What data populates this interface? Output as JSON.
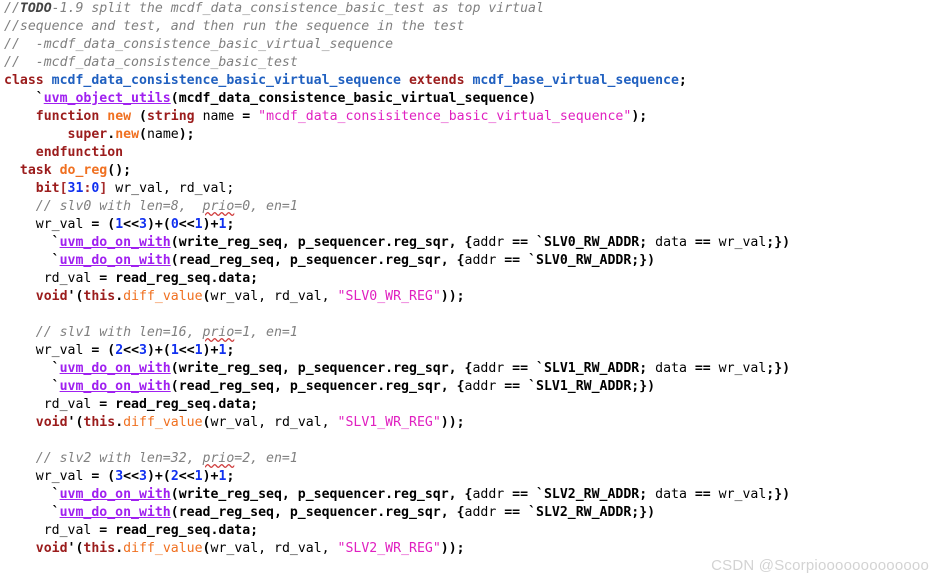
{
  "editor": {
    "language": "SystemVerilog",
    "background": "#ffffff",
    "font_size_px": 13.2,
    "line_height_px": 18
  },
  "colors": {
    "comment": "#808080",
    "keyword": "#9b1c1c",
    "type": "#2060c0",
    "string": "#e020c0",
    "macro": "#a020f0",
    "function": "#f07020",
    "number": "#1030f0",
    "plain": "#000000",
    "watermark": "#d3d3d3"
  },
  "watermark": {
    "text": "CSDN @Scorpiooooooooooooo"
  },
  "code": {
    "lines": [
      {
        "n": 1,
        "indent": 0,
        "tokens": [
          {
            "t": "//",
            "c": "c-comment"
          },
          {
            "t": "TODO",
            "c": "c-commentb"
          },
          {
            "t": "-1.9 split the mcdf_data_consistence_basic_test as top virtual",
            "c": "c-comment"
          }
        ]
      },
      {
        "n": 2,
        "indent": 0,
        "tokens": [
          {
            "t": "//sequence and test, and then run the sequence in the test",
            "c": "c-comment"
          }
        ]
      },
      {
        "n": 3,
        "indent": 0,
        "tokens": [
          {
            "t": "//  -mcdf_data_consistence_basic_virtual_sequence",
            "c": "c-comment"
          }
        ]
      },
      {
        "n": 4,
        "indent": 0,
        "tokens": [
          {
            "t": "//  -mcdf_data_consistence_basic_test",
            "c": "c-comment"
          }
        ]
      },
      {
        "n": 5,
        "indent": 0,
        "tokens": [
          {
            "t": "class",
            "c": "c-keyword"
          },
          {
            "t": " ",
            "c": "c-plain"
          },
          {
            "t": "mcdf_data_consistence_basic_virtual_sequence",
            "c": "c-type"
          },
          {
            "t": " ",
            "c": "c-plain"
          },
          {
            "t": "extends",
            "c": "c-keyword"
          },
          {
            "t": " ",
            "c": "c-plain"
          },
          {
            "t": "mcdf_base_virtual_sequence",
            "c": "c-type"
          },
          {
            "t": ";",
            "c": "c-punct"
          }
        ]
      },
      {
        "n": 6,
        "indent": 4,
        "tokens": [
          {
            "t": "`",
            "c": "c-tick"
          },
          {
            "t": "uvm_object_utils",
            "c": "c-macro"
          },
          {
            "t": "(",
            "c": "c-punct"
          },
          {
            "t": "mcdf_data_consistence_basic_virtual_sequence",
            "c": "c-bold"
          },
          {
            "t": ")",
            "c": "c-punct"
          }
        ]
      },
      {
        "n": 7,
        "indent": 4,
        "tokens": [
          {
            "t": "function",
            "c": "c-keyword"
          },
          {
            "t": " ",
            "c": "c-plain"
          },
          {
            "t": "new",
            "c": "c-func"
          },
          {
            "t": " (",
            "c": "c-punct"
          },
          {
            "t": "string",
            "c": "c-keyword"
          },
          {
            "t": " ",
            "c": "c-plain"
          },
          {
            "t": "name",
            "c": "c-plain"
          },
          {
            "t": " = ",
            "c": "c-punct"
          },
          {
            "t": "\"mcdf_data_consisitence_basic_virtual_sequence\"",
            "c": "c-string"
          },
          {
            "t": ");",
            "c": "c-punct"
          }
        ]
      },
      {
        "n": 8,
        "indent": 8,
        "tokens": [
          {
            "t": "super",
            "c": "c-keyword"
          },
          {
            "t": ".",
            "c": "c-punct"
          },
          {
            "t": "new",
            "c": "c-func"
          },
          {
            "t": "(",
            "c": "c-punct"
          },
          {
            "t": "name",
            "c": "c-plain"
          },
          {
            "t": ");",
            "c": "c-punct"
          }
        ]
      },
      {
        "n": 9,
        "indent": 4,
        "tokens": [
          {
            "t": "endfunction",
            "c": "c-keyword"
          }
        ]
      },
      {
        "n": 10,
        "indent": 2,
        "tokens": [
          {
            "t": "task",
            "c": "c-keyword"
          },
          {
            "t": " ",
            "c": "c-plain"
          },
          {
            "t": "do_reg",
            "c": "c-func"
          },
          {
            "t": "();",
            "c": "c-punct"
          }
        ]
      },
      {
        "n": 11,
        "indent": 4,
        "tokens": [
          {
            "t": "bit",
            "c": "c-keyword"
          },
          {
            "t": "[",
            "c": "c-kw2"
          },
          {
            "t": "31",
            "c": "c-num"
          },
          {
            "t": ":",
            "c": "c-kw2"
          },
          {
            "t": "0",
            "c": "c-num"
          },
          {
            "t": "]",
            "c": "c-kw2"
          },
          {
            "t": " ",
            "c": "c-plain"
          },
          {
            "t": "wr_val, rd_val;",
            "c": "c-plain"
          }
        ]
      },
      {
        "n": 12,
        "indent": 4,
        "tokens": [
          {
            "t": "// slv0 with len=8,  ",
            "c": "c-comment"
          },
          {
            "t": "prio",
            "c": "c-comment c-squiggle"
          },
          {
            "t": "=0, en=1",
            "c": "c-comment"
          }
        ]
      },
      {
        "n": 13,
        "indent": 4,
        "tokens": [
          {
            "t": "wr_val",
            "c": "c-plain"
          },
          {
            "t": " = ",
            "c": "c-punct"
          },
          {
            "t": "(",
            "c": "c-punct"
          },
          {
            "t": "1",
            "c": "c-num"
          },
          {
            "t": "<<",
            "c": "c-punct"
          },
          {
            "t": "3",
            "c": "c-num"
          },
          {
            "t": ")+(",
            "c": "c-punct"
          },
          {
            "t": "0",
            "c": "c-num"
          },
          {
            "t": "<<",
            "c": "c-punct"
          },
          {
            "t": "1",
            "c": "c-num"
          },
          {
            "t": ")+",
            "c": "c-punct"
          },
          {
            "t": "1",
            "c": "c-num"
          },
          {
            "t": ";",
            "c": "c-punct"
          }
        ]
      },
      {
        "n": 14,
        "indent": 6,
        "tokens": [
          {
            "t": "`",
            "c": "c-tick"
          },
          {
            "t": "uvm_do_on_with",
            "c": "c-macro"
          },
          {
            "t": "(",
            "c": "c-punct"
          },
          {
            "t": "write_reg_seq, p_sequencer.reg_sqr, {",
            "c": "c-bold"
          },
          {
            "t": "addr",
            "c": "c-plain"
          },
          {
            "t": " == ",
            "c": "c-punct"
          },
          {
            "t": "`",
            "c": "c-tick"
          },
          {
            "t": "SLV0_RW_ADDR",
            "c": "c-bold"
          },
          {
            "t": "; ",
            "c": "c-punct"
          },
          {
            "t": "data",
            "c": "c-plain"
          },
          {
            "t": " == ",
            "c": "c-punct"
          },
          {
            "t": "wr_val",
            "c": "c-plain"
          },
          {
            "t": ";})",
            "c": "c-punct"
          }
        ]
      },
      {
        "n": 15,
        "indent": 6,
        "tokens": [
          {
            "t": "`",
            "c": "c-tick"
          },
          {
            "t": "uvm_do_on_with",
            "c": "c-macro"
          },
          {
            "t": "(",
            "c": "c-punct"
          },
          {
            "t": "read_reg_seq, p_sequencer.reg_sqr, {",
            "c": "c-bold"
          },
          {
            "t": "addr",
            "c": "c-plain"
          },
          {
            "t": " == ",
            "c": "c-punct"
          },
          {
            "t": "`",
            "c": "c-tick"
          },
          {
            "t": "SLV0_RW_ADDR",
            "c": "c-bold"
          },
          {
            "t": ";})",
            "c": "c-punct"
          }
        ]
      },
      {
        "n": 16,
        "indent": 5,
        "tokens": [
          {
            "t": "rd_val",
            "c": "c-plain"
          },
          {
            "t": " = ",
            "c": "c-punct"
          },
          {
            "t": "read_reg_seq.data;",
            "c": "c-bold"
          }
        ]
      },
      {
        "n": 17,
        "indent": 4,
        "tokens": [
          {
            "t": "void",
            "c": "c-keyword"
          },
          {
            "t": "'(",
            "c": "c-punct"
          },
          {
            "t": "this",
            "c": "c-keyword"
          },
          {
            "t": ".",
            "c": "c-punct"
          },
          {
            "t": "diff_value",
            "c": "c-func2"
          },
          {
            "t": "(",
            "c": "c-punct"
          },
          {
            "t": "wr_val, rd_val, ",
            "c": "c-plain"
          },
          {
            "t": "\"SLV0_WR_REG\"",
            "c": "c-string"
          },
          {
            "t": "));",
            "c": "c-punct"
          }
        ]
      },
      {
        "n": 18,
        "indent": 0,
        "tokens": []
      },
      {
        "n": 19,
        "indent": 4,
        "tokens": [
          {
            "t": "// slv1 with len=16, ",
            "c": "c-comment"
          },
          {
            "t": "prio",
            "c": "c-comment c-squiggle"
          },
          {
            "t": "=1, en=1",
            "c": "c-comment"
          }
        ]
      },
      {
        "n": 20,
        "indent": 4,
        "tokens": [
          {
            "t": "wr_val",
            "c": "c-plain"
          },
          {
            "t": " = ",
            "c": "c-punct"
          },
          {
            "t": "(",
            "c": "c-punct"
          },
          {
            "t": "2",
            "c": "c-num"
          },
          {
            "t": "<<",
            "c": "c-punct"
          },
          {
            "t": "3",
            "c": "c-num"
          },
          {
            "t": ")+(",
            "c": "c-punct"
          },
          {
            "t": "1",
            "c": "c-num"
          },
          {
            "t": "<<",
            "c": "c-punct"
          },
          {
            "t": "1",
            "c": "c-num"
          },
          {
            "t": ")+",
            "c": "c-punct"
          },
          {
            "t": "1",
            "c": "c-num"
          },
          {
            "t": ";",
            "c": "c-punct"
          }
        ]
      },
      {
        "n": 21,
        "indent": 6,
        "tokens": [
          {
            "t": "`",
            "c": "c-tick"
          },
          {
            "t": "uvm_do_on_with",
            "c": "c-macro"
          },
          {
            "t": "(",
            "c": "c-punct"
          },
          {
            "t": "write_reg_seq, p_sequencer.reg_sqr, {",
            "c": "c-bold"
          },
          {
            "t": "addr",
            "c": "c-plain"
          },
          {
            "t": " == ",
            "c": "c-punct"
          },
          {
            "t": "`",
            "c": "c-tick"
          },
          {
            "t": "SLV1_RW_ADDR",
            "c": "c-bold"
          },
          {
            "t": "; ",
            "c": "c-punct"
          },
          {
            "t": "data",
            "c": "c-plain"
          },
          {
            "t": " == ",
            "c": "c-punct"
          },
          {
            "t": "wr_val",
            "c": "c-plain"
          },
          {
            "t": ";})",
            "c": "c-punct"
          }
        ]
      },
      {
        "n": 22,
        "indent": 6,
        "tokens": [
          {
            "t": "`",
            "c": "c-tick"
          },
          {
            "t": "uvm_do_on_with",
            "c": "c-macro"
          },
          {
            "t": "(",
            "c": "c-punct"
          },
          {
            "t": "read_reg_seq, p_sequencer.reg_sqr, {",
            "c": "c-bold"
          },
          {
            "t": "addr",
            "c": "c-plain"
          },
          {
            "t": " == ",
            "c": "c-punct"
          },
          {
            "t": "`",
            "c": "c-tick"
          },
          {
            "t": "SLV1_RW_ADDR",
            "c": "c-bold"
          },
          {
            "t": ";})",
            "c": "c-punct"
          }
        ]
      },
      {
        "n": 23,
        "indent": 5,
        "tokens": [
          {
            "t": "rd_val",
            "c": "c-plain"
          },
          {
            "t": " = ",
            "c": "c-punct"
          },
          {
            "t": "read_reg_seq.data;",
            "c": "c-bold"
          }
        ]
      },
      {
        "n": 24,
        "indent": 4,
        "tokens": [
          {
            "t": "void",
            "c": "c-keyword"
          },
          {
            "t": "'(",
            "c": "c-punct"
          },
          {
            "t": "this",
            "c": "c-keyword"
          },
          {
            "t": ".",
            "c": "c-punct"
          },
          {
            "t": "diff_value",
            "c": "c-func2"
          },
          {
            "t": "(",
            "c": "c-punct"
          },
          {
            "t": "wr_val, rd_val, ",
            "c": "c-plain"
          },
          {
            "t": "\"SLV1_WR_REG\"",
            "c": "c-string"
          },
          {
            "t": "));",
            "c": "c-punct"
          }
        ]
      },
      {
        "n": 25,
        "indent": 0,
        "tokens": []
      },
      {
        "n": 26,
        "indent": 4,
        "tokens": [
          {
            "t": "// slv2 with len=32, ",
            "c": "c-comment"
          },
          {
            "t": "prio",
            "c": "c-comment c-squiggle"
          },
          {
            "t": "=2, en=1",
            "c": "c-comment"
          }
        ]
      },
      {
        "n": 27,
        "indent": 4,
        "tokens": [
          {
            "t": "wr_val",
            "c": "c-plain"
          },
          {
            "t": " = ",
            "c": "c-punct"
          },
          {
            "t": "(",
            "c": "c-punct"
          },
          {
            "t": "3",
            "c": "c-num"
          },
          {
            "t": "<<",
            "c": "c-punct"
          },
          {
            "t": "3",
            "c": "c-num"
          },
          {
            "t": ")+(",
            "c": "c-punct"
          },
          {
            "t": "2",
            "c": "c-num"
          },
          {
            "t": "<<",
            "c": "c-punct"
          },
          {
            "t": "1",
            "c": "c-num"
          },
          {
            "t": ")+",
            "c": "c-punct"
          },
          {
            "t": "1",
            "c": "c-num"
          },
          {
            "t": ";",
            "c": "c-punct"
          }
        ]
      },
      {
        "n": 28,
        "indent": 6,
        "tokens": [
          {
            "t": "`",
            "c": "c-tick"
          },
          {
            "t": "uvm_do_on_with",
            "c": "c-macro"
          },
          {
            "t": "(",
            "c": "c-punct"
          },
          {
            "t": "write_reg_seq, p_sequencer.reg_sqr, {",
            "c": "c-bold"
          },
          {
            "t": "addr",
            "c": "c-plain"
          },
          {
            "t": " == ",
            "c": "c-punct"
          },
          {
            "t": "`",
            "c": "c-tick"
          },
          {
            "t": "SLV2_RW_ADDR",
            "c": "c-bold"
          },
          {
            "t": "; ",
            "c": "c-punct"
          },
          {
            "t": "data",
            "c": "c-plain"
          },
          {
            "t": " == ",
            "c": "c-punct"
          },
          {
            "t": "wr_val",
            "c": "c-plain"
          },
          {
            "t": ";})",
            "c": "c-punct"
          }
        ]
      },
      {
        "n": 29,
        "indent": 6,
        "tokens": [
          {
            "t": "`",
            "c": "c-tick"
          },
          {
            "t": "uvm_do_on_with",
            "c": "c-macro"
          },
          {
            "t": "(",
            "c": "c-punct"
          },
          {
            "t": "read_reg_seq, p_sequencer.reg_sqr, {",
            "c": "c-bold"
          },
          {
            "t": "addr",
            "c": "c-plain"
          },
          {
            "t": " == ",
            "c": "c-punct"
          },
          {
            "t": "`",
            "c": "c-tick"
          },
          {
            "t": "SLV2_RW_ADDR",
            "c": "c-bold"
          },
          {
            "t": ";})",
            "c": "c-punct"
          }
        ]
      },
      {
        "n": 30,
        "indent": 5,
        "tokens": [
          {
            "t": "rd_val",
            "c": "c-plain"
          },
          {
            "t": " = ",
            "c": "c-punct"
          },
          {
            "t": "read_reg_seq.data;",
            "c": "c-bold"
          }
        ]
      },
      {
        "n": 31,
        "indent": 4,
        "tokens": [
          {
            "t": "void",
            "c": "c-keyword"
          },
          {
            "t": "'(",
            "c": "c-punct"
          },
          {
            "t": "this",
            "c": "c-keyword"
          },
          {
            "t": ".",
            "c": "c-punct"
          },
          {
            "t": "diff_value",
            "c": "c-func2"
          },
          {
            "t": "(",
            "c": "c-punct"
          },
          {
            "t": "wr_val, rd_val, ",
            "c": "c-plain"
          },
          {
            "t": "\"SLV2_WR_REG\"",
            "c": "c-string"
          },
          {
            "t": "));",
            "c": "c-punct"
          }
        ]
      }
    ]
  }
}
